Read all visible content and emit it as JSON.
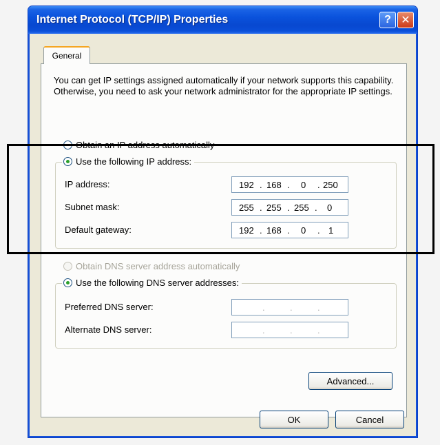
{
  "window": {
    "title": "Internet Protocol (TCP/IP) Properties",
    "help_label": "?",
    "close_label": "✕"
  },
  "tabs": [
    {
      "label": "General",
      "active": true
    }
  ],
  "intro_text": "You can get IP settings assigned automatically if your network supports this capability. Otherwise, you need to ask your network administrator for the appropriate IP settings.",
  "ip_section": {
    "auto_label": "Obtain an IP address automatically",
    "manual_label": "Use the following IP address:",
    "selected": "manual",
    "fields": [
      {
        "label": "IP address:",
        "octets": [
          "192",
          "168",
          "0",
          "250"
        ]
      },
      {
        "label": "Subnet mask:",
        "octets": [
          "255",
          "255",
          "255",
          "0"
        ]
      },
      {
        "label": "Default gateway:",
        "octets": [
          "192",
          "168",
          "0",
          "1"
        ]
      }
    ]
  },
  "dns_section": {
    "auto_label": "Obtain DNS server address automatically",
    "auto_disabled": true,
    "manual_label": "Use the following DNS server addresses:",
    "selected": "manual",
    "fields": [
      {
        "label": "Preferred DNS server:",
        "octets": [
          "",
          "",
          "",
          ""
        ]
      },
      {
        "label": "Alternate DNS server:",
        "octets": [
          "",
          "",
          "",
          ""
        ]
      }
    ]
  },
  "buttons": {
    "advanced": "Advanced...",
    "ok": "OK",
    "cancel": "Cancel"
  },
  "colors": {
    "title_bar": "#0a52dc",
    "dialog_bg": "#ece9d8",
    "tab_accent": "#f5a623",
    "radio_dot": "#2ba02b",
    "highlight_box": "#000000"
  }
}
